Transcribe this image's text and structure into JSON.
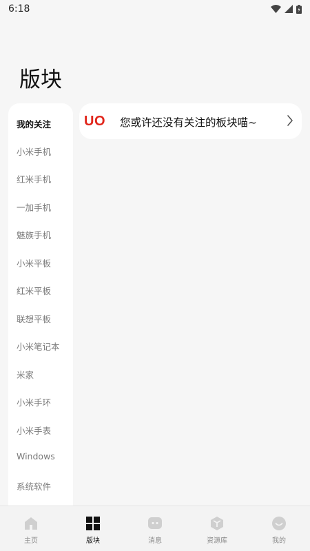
{
  "status_bar": {
    "time": "6:18",
    "icons": [
      "wifi-icon",
      "signal-icon",
      "battery-charging-icon"
    ]
  },
  "page": {
    "title": "版块"
  },
  "sidebar": {
    "items": [
      {
        "label": "我的关注",
        "active": true
      },
      {
        "label": "小米手机",
        "active": false
      },
      {
        "label": "红米手机",
        "active": false
      },
      {
        "label": "一加手机",
        "active": false
      },
      {
        "label": "魅族手机",
        "active": false
      },
      {
        "label": "小米平板",
        "active": false
      },
      {
        "label": "红米平板",
        "active": false
      },
      {
        "label": "联想平板",
        "active": false
      },
      {
        "label": "小米笔记本",
        "active": false
      },
      {
        "label": "米家",
        "active": false
      },
      {
        "label": "小米手环",
        "active": false
      },
      {
        "label": "小米手表",
        "active": false
      },
      {
        "label": "Windows",
        "active": false
      },
      {
        "label": "系统软件",
        "active": false
      }
    ]
  },
  "empty_state": {
    "emoticon": "UO",
    "message": "您或许还没有关注的板块喵~",
    "emoticon_color": "#e1251b"
  },
  "bottom_nav": {
    "tabs": [
      {
        "label": "主页",
        "icon": "home-icon",
        "active": false
      },
      {
        "label": "版块",
        "icon": "grid-icon",
        "active": true
      },
      {
        "label": "消息",
        "icon": "message-icon",
        "active": false
      },
      {
        "label": "资源库",
        "icon": "cube-icon",
        "active": false
      },
      {
        "label": "我的",
        "icon": "smile-icon",
        "active": false
      }
    ]
  }
}
